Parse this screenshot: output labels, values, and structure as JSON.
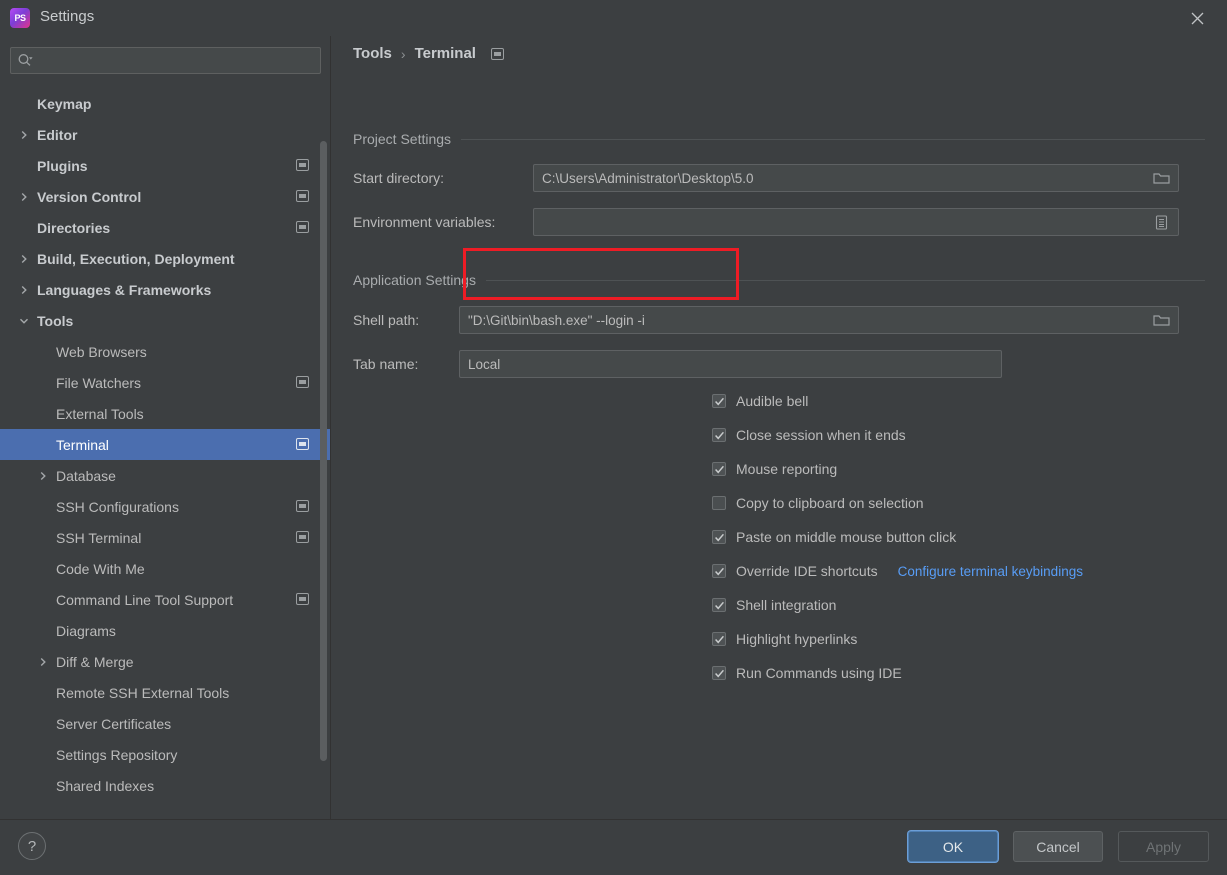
{
  "window": {
    "title": "Settings",
    "app_icon": "phpstorm-icon",
    "app_icon_text": "PS",
    "close_icon": "close-icon"
  },
  "sidebar": {
    "search": {
      "placeholder": "",
      "value": "",
      "icon": "search-icon"
    },
    "items": [
      {
        "label": "Keymap",
        "indent": 37,
        "arrow": "none",
        "bold": true,
        "badge": false,
        "selected": false
      },
      {
        "label": "Editor",
        "indent": 37,
        "arrow": "right",
        "bold": true,
        "badge": false,
        "selected": false
      },
      {
        "label": "Plugins",
        "indent": 37,
        "arrow": "none",
        "bold": true,
        "badge": true,
        "selected": false
      },
      {
        "label": "Version Control",
        "indent": 37,
        "arrow": "right",
        "bold": true,
        "badge": true,
        "selected": false
      },
      {
        "label": "Directories",
        "indent": 37,
        "arrow": "none",
        "bold": true,
        "badge": true,
        "selected": false
      },
      {
        "label": "Build, Execution, Deployment",
        "indent": 37,
        "arrow": "right",
        "bold": true,
        "badge": false,
        "selected": false
      },
      {
        "label": "Languages & Frameworks",
        "indent": 37,
        "arrow": "right",
        "bold": true,
        "badge": false,
        "selected": false
      },
      {
        "label": "Tools",
        "indent": 37,
        "arrow": "down",
        "bold": true,
        "badge": false,
        "selected": false
      },
      {
        "label": "Web Browsers",
        "indent": 56,
        "arrow": "none",
        "bold": false,
        "badge": false,
        "selected": false
      },
      {
        "label": "File Watchers",
        "indent": 56,
        "arrow": "none",
        "bold": false,
        "badge": true,
        "selected": false
      },
      {
        "label": "External Tools",
        "indent": 56,
        "arrow": "none",
        "bold": false,
        "badge": false,
        "selected": false
      },
      {
        "label": "Terminal",
        "indent": 56,
        "arrow": "none",
        "bold": false,
        "badge": true,
        "selected": true
      },
      {
        "label": "Database",
        "indent": 56,
        "arrow": "right",
        "bold": false,
        "badge": false,
        "selected": false
      },
      {
        "label": "SSH Configurations",
        "indent": 56,
        "arrow": "none",
        "bold": false,
        "badge": true,
        "selected": false
      },
      {
        "label": "SSH Terminal",
        "indent": 56,
        "arrow": "none",
        "bold": false,
        "badge": true,
        "selected": false
      },
      {
        "label": "Code With Me",
        "indent": 56,
        "arrow": "none",
        "bold": false,
        "badge": false,
        "selected": false
      },
      {
        "label": "Command Line Tool Support",
        "indent": 56,
        "arrow": "none",
        "bold": false,
        "badge": true,
        "selected": false
      },
      {
        "label": "Diagrams",
        "indent": 56,
        "arrow": "none",
        "bold": false,
        "badge": false,
        "selected": false
      },
      {
        "label": "Diff & Merge",
        "indent": 56,
        "arrow": "right",
        "bold": false,
        "badge": false,
        "selected": false
      },
      {
        "label": "Remote SSH External Tools",
        "indent": 56,
        "arrow": "none",
        "bold": false,
        "badge": false,
        "selected": false
      },
      {
        "label": "Server Certificates",
        "indent": 56,
        "arrow": "none",
        "bold": false,
        "badge": false,
        "selected": false
      },
      {
        "label": "Settings Repository",
        "indent": 56,
        "arrow": "none",
        "bold": false,
        "badge": false,
        "selected": false
      },
      {
        "label": "Shared Indexes",
        "indent": 56,
        "arrow": "none",
        "bold": false,
        "badge": false,
        "selected": false
      }
    ]
  },
  "main": {
    "breadcrumb": {
      "parent": "Tools",
      "separator": "›",
      "current": "Terminal",
      "badge_icon": "project-scope-icon"
    },
    "project_settings": {
      "header": "Project Settings",
      "start_directory": {
        "label": "Start directory:",
        "value": "C:\\Users\\Administrator\\Desktop\\5.0",
        "placeholder": "",
        "browse_icon": "folder-icon"
      },
      "environment_variables": {
        "label": "Environment variables:",
        "value": "",
        "placeholder": "",
        "browse_icon": "list-icon"
      }
    },
    "application_settings": {
      "header": "Application Settings",
      "shell_path": {
        "label": "Shell path:",
        "value": "\"D:\\Git\\bin\\bash.exe\" --login -i",
        "placeholder": "",
        "browse_icon": "folder-icon",
        "highlight_color": "#ee1c25"
      },
      "tab_name": {
        "label": "Tab name:",
        "value": "Local",
        "placeholder": ""
      },
      "checkboxes": [
        {
          "label": "Audible bell",
          "checked": true,
          "link": null
        },
        {
          "label": "Close session when it ends",
          "checked": true,
          "link": null
        },
        {
          "label": "Mouse reporting",
          "checked": true,
          "link": null
        },
        {
          "label": "Copy to clipboard on selection",
          "checked": false,
          "link": null
        },
        {
          "label": "Paste on middle mouse button click",
          "checked": true,
          "link": null
        },
        {
          "label": "Override IDE shortcuts",
          "checked": true,
          "link": "Configure terminal keybindings"
        },
        {
          "label": "Shell integration",
          "checked": true,
          "link": null
        },
        {
          "label": "Highlight hyperlinks",
          "checked": true,
          "link": null
        },
        {
          "label": "Run Commands using IDE",
          "checked": true,
          "link": null
        }
      ]
    }
  },
  "footer": {
    "help_label": "?",
    "ok_label": "OK",
    "cancel_label": "Cancel",
    "apply_label": "Apply"
  },
  "colors": {
    "window_bg": "#3c3f41",
    "selection_blue": "#4b6eaf",
    "link_blue": "#589df6",
    "ok_button_blue": "#3d6185",
    "annotation_red": "#ee1c25"
  }
}
